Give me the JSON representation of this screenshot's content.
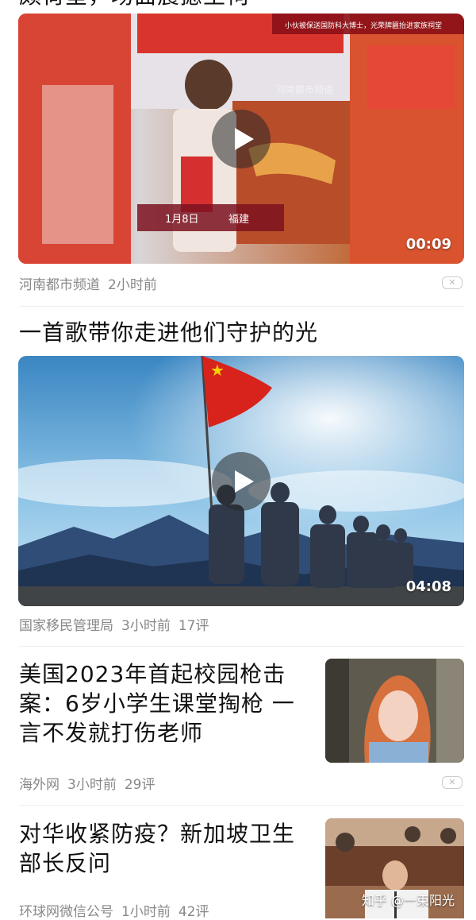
{
  "items": [
    {
      "cut_title": "颇荷堂，场面震撼至祠",
      "banner": "小伙被保送国防科大博士，光荣牌匾抬进家族祠堂",
      "lower_third_date": "1月8日",
      "lower_third_place": "福建",
      "watermark": "河南都市频道",
      "duration": "00:09",
      "source": "河南都市频道",
      "time": "2小时前"
    },
    {
      "title": "一首歌带你走进他们守护的光",
      "duration": "04:08",
      "source": "国家移民管理局",
      "time": "3小时前",
      "comments": "17评"
    },
    {
      "title": "美国2023年首起校园枪击案：6岁小学生课堂掏枪 一言不发就打伤老师",
      "source": "海外网",
      "time": "3小时前",
      "comments": "29评"
    },
    {
      "title": "对华收紧防疫？新加坡卫生部长反问",
      "source": "环球网微信公号",
      "time": "1小时前",
      "comments": "42评"
    }
  ],
  "page_watermark": "知乎 @一束阳光",
  "icons": {
    "play": "play-icon",
    "dismiss": "close-icon"
  }
}
